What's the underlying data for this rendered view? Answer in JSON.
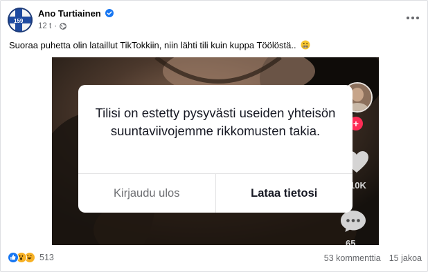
{
  "post": {
    "author": "Ano Turtiainen",
    "timestamp": "12 t",
    "separator": "·",
    "audience_icon": "globe-icon",
    "more_icon": "more-options-icon",
    "text": "Suoraa puhetta olin lataillut TikTokkiin, niin lähti tili kuin kuppa Töölöstä..",
    "text_emoji": "grimacing-face-emoji",
    "avatar_label": "159"
  },
  "media": {
    "tiktok_side": {
      "likes": "10K",
      "comments": "65",
      "plus": "+"
    },
    "dialog": {
      "message": "Tilisi on estetty pysyvästi useiden yhteisön suuntaviivojemme rikkomusten takia.",
      "logout_label": "Kirjaudu ulos",
      "download_label": "Lataa tietosi"
    }
  },
  "footer": {
    "reactions": [
      "like-icon",
      "wow-icon",
      "haha-icon"
    ],
    "reaction_count": "513",
    "comments": "53 kommenttia",
    "shares": "15 jakoa"
  },
  "colors": {
    "verified": "#1877f2",
    "tiktok_red": "#fe2c55",
    "secondary_text": "#65676b"
  }
}
